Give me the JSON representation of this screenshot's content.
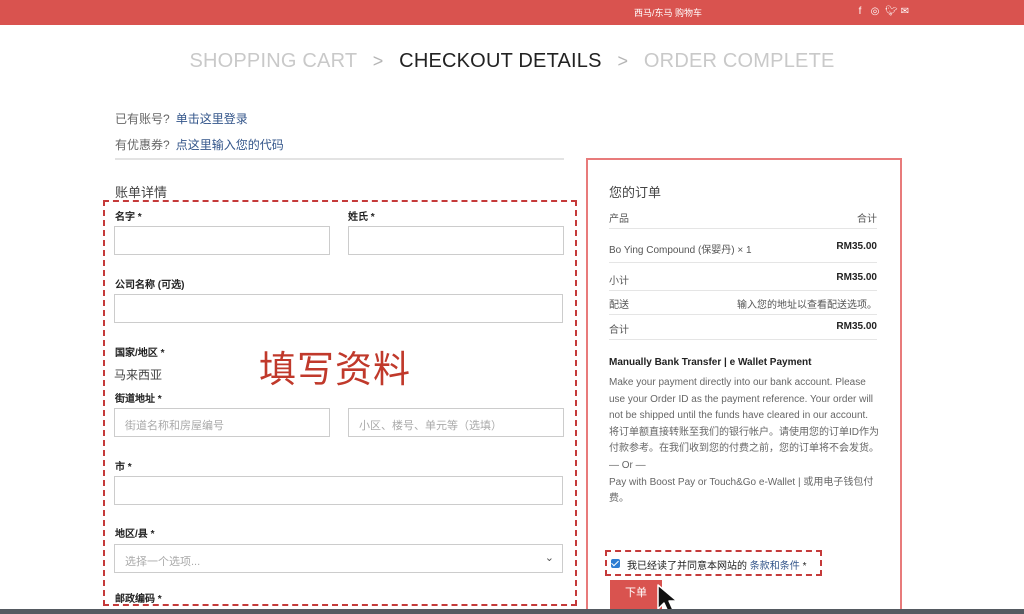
{
  "topbar": {
    "nav_text": "西马/东马 购物车",
    "social_icons": [
      "facebook-icon",
      "instagram-icon",
      "twitter-icon",
      "mail-icon"
    ]
  },
  "steps": {
    "cart": "SHOPPING CART",
    "details": "CHECKOUT DETAILS",
    "complete": "ORDER COMPLETE",
    "separator": ">"
  },
  "notices": {
    "login_label": "已有账号?",
    "login_link": "单击这里登录",
    "coupon_label": "有优惠券?",
    "coupon_link": "点这里输入您的代码"
  },
  "billing": {
    "title": "账单详情",
    "first_name_label": "名字",
    "last_name_label": "姓氏",
    "company_label": "公司名称 (可选)",
    "country_label": "国家/地区",
    "country_value": "马来西亚",
    "street_label": "街道地址",
    "street_placeholder": "街道名称和房屋编号",
    "street2_placeholder": "小区、楼号、单元等（选填）",
    "city_label": "市",
    "state_label": "地区/县",
    "state_select": "选择一个选项...",
    "postcode_label": "邮政编码",
    "required_mark": "*"
  },
  "overlay": {
    "text": "填写资料"
  },
  "order": {
    "title": "您的订单",
    "col_product": "产品",
    "col_total": "合计",
    "item_name": "Bo Ying Compound (保婴丹)  × 1",
    "item_price": "RM35.00",
    "subtotal_label": "小计",
    "subtotal_value": "RM35.00",
    "shipping_label": "配送",
    "shipping_value": "输入您的地址以查看配送选项。",
    "total_label": "合计",
    "total_value": "RM35.00"
  },
  "payment": {
    "title": "Manually Bank Transfer | e Wallet Payment",
    "description": "Make your payment directly into our bank account. Please use your Order ID as the payment reference. Your order will not be shipped until the funds have cleared in our account.\n将订单额直接转账至我们的银行帐户。请使用您的订单ID作为付款参考。在我们收到您的付费之前，您的订单将不会发货。\n— Or —\nPay with Boost Pay or Touch&Go e-Wallet | 或用电子钱包付费。"
  },
  "terms": {
    "text": "我已经读了并同意本网站的",
    "link": "条款和条件",
    "required_mark": "*",
    "checked": true
  },
  "place_order": {
    "label": "下单"
  },
  "colors": {
    "accent": "#d9534f",
    "link": "#33558a",
    "annotation": "#c53a3a"
  }
}
